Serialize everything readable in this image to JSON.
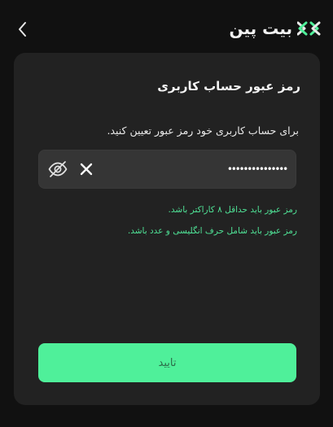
{
  "header": {
    "back_icon": "chevron-left-icon",
    "brand_name": "بیت پین",
    "brand_icon": "bitpin-logo-icon"
  },
  "card": {
    "title": "رمز عبور حساب کاربری",
    "description": "برای حساب کاربری خود رمز عبور تعیین کنید.",
    "password_field": {
      "value": "•••••••••••••••",
      "toggle_icon": "eye-off-icon",
      "clear_icon": "close-icon"
    },
    "rules": [
      "رمز عبور باید حداقل ۸ کاراکتر باشد.",
      "رمز عبور باید شامل حرف انگلیسی و عدد باشد."
    ],
    "confirm_label": "تایید"
  },
  "colors": {
    "background": "#111111",
    "card": "#222222",
    "field": "#353535",
    "accent_green": "#4ff09a",
    "rule_text": "#4fe296"
  }
}
